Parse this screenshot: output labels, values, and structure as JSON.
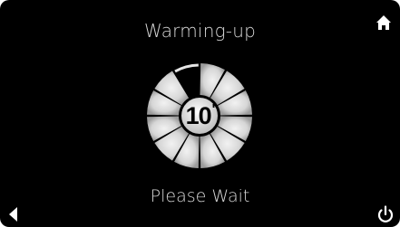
{
  "header": {
    "title": "Warming-up"
  },
  "timer": {
    "value": "10",
    "unit": "'"
  },
  "status": {
    "text": "Please Wait"
  },
  "icons": {
    "home": "home-icon",
    "back": "back-arrow-icon",
    "power": "power-icon"
  },
  "progress": {
    "segments_total": 12,
    "segments_lit": 11
  },
  "colors": {
    "background": "#000000",
    "text": "#d8d8d8",
    "segment": "#d9d9d9"
  }
}
